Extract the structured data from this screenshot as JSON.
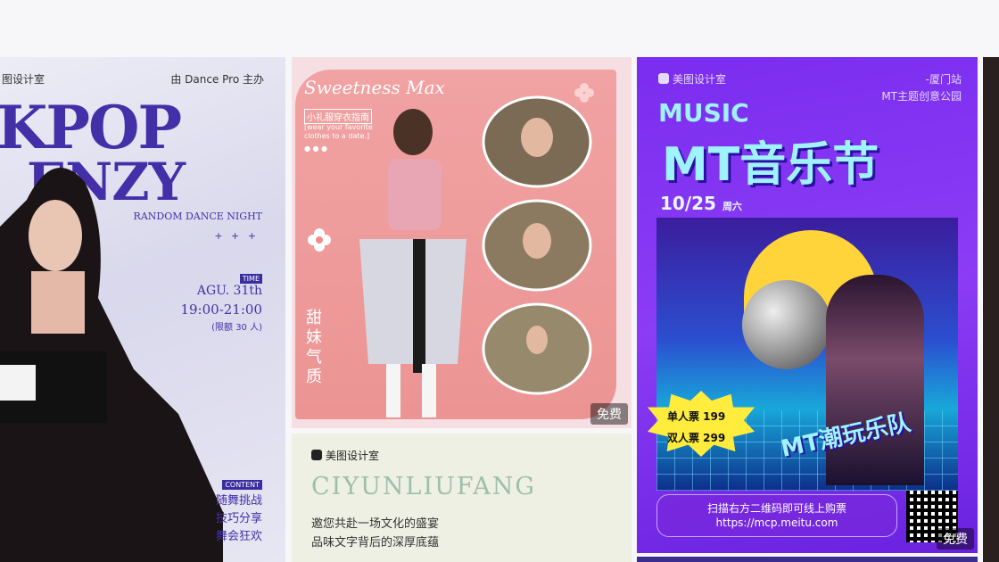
{
  "badges": {
    "free": "免费"
  },
  "card1": {
    "brand": "图设计室",
    "host": "由 Dance Pro 主办",
    "title_line1": "KPOP",
    "title_line2": "ENZY",
    "subtitle": "RANDOM DANCE NIGHT",
    "stars": "+ + +",
    "time_tag": "TIME",
    "date": "AGU. 31th",
    "hours": "19:00-21:00",
    "limit": "(限额 30 人)",
    "content_tag": "CONTENT",
    "content_items": [
      "随舞挑战",
      "技巧分享",
      "舞会狂欢"
    ]
  },
  "card2": {
    "script_title": "Sweetness Max",
    "sub1": "小礼服穿衣指南",
    "sub2": "[wear your favorite clothes to a date.]",
    "vertical": "甜妹气质"
  },
  "card3": {
    "brand": "美图设计室",
    "title": "CIYUNLIUFANG",
    "line1": "邀您共赴一场文化的盛宴",
    "line2": "品味文字背后的深厚底蕴"
  },
  "card4": {
    "brand": "美图设计室",
    "city": "-厦门站",
    "park": "MT主题创意公园",
    "music": "MUSIC",
    "festival": "MT音乐节",
    "date": "10/25",
    "date_suffix": "周六",
    "price1": "单人票 199",
    "price2": "双人票 299",
    "band": "MT潮玩乐队",
    "qr_text": "扫描右方二维码即可线上购票",
    "url": "https://mcp.meitu.com"
  },
  "colors": {
    "kpop_purple": "#4330a8",
    "fest_purple": "#7b2df0",
    "pink_panel": "#f1a2a2",
    "cyan_text": "#9ff3ff"
  }
}
